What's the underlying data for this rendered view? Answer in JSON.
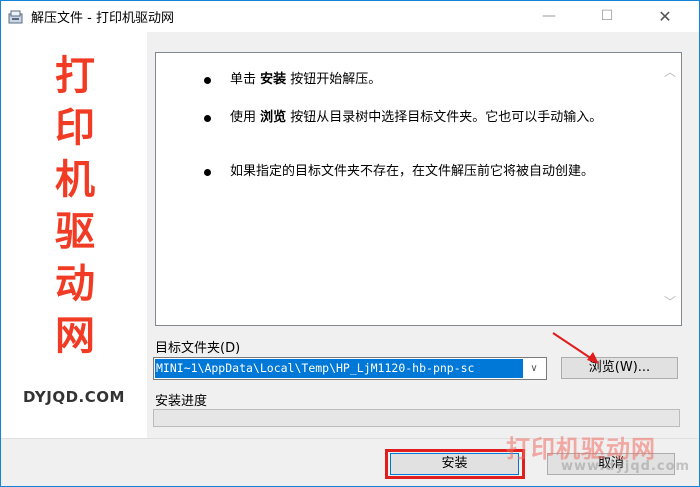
{
  "window": {
    "title": "解压文件 - 打印机驱动网",
    "controls": {
      "minimize": "—",
      "maximize": "☐",
      "close": "✕"
    },
    "icon": "installer-icon"
  },
  "sidebar": {
    "brand_chars": [
      "打",
      "印",
      "机",
      "驱",
      "动",
      "网"
    ],
    "brand_url": "DYJQD.COM",
    "brand_color": "#f23b24"
  },
  "info": {
    "bullets": [
      {
        "pre": "单击 ",
        "bold": "安装",
        "post": " 按钮开始解压。"
      },
      {
        "pre": "使用 ",
        "bold": "浏览",
        "post": " 按钮从目录树中选择目标文件夹。它也可以手动输入。"
      },
      {
        "pre": "",
        "bold": "",
        "post": "如果指定的目标文件夹不存在，在文件解压前它将被自动创建。"
      }
    ]
  },
  "destination": {
    "label": "目标文件夹(D)",
    "value": "MINI~1\\AppData\\Local\\Temp\\HP_LjM1120-hb-pnp-sc"
  },
  "browse_button": {
    "label": "浏览(W)..."
  },
  "progress": {
    "label": "安装进度",
    "fraction": 0
  },
  "buttons": {
    "install": "安装",
    "cancel": "取消"
  },
  "watermark": {
    "title": "打印机驱动网",
    "url": "www.dyjqd.com"
  },
  "colors": {
    "accent": "#0078d7",
    "annotation_red": "#e01e1e",
    "title_border": "#1783d6"
  }
}
